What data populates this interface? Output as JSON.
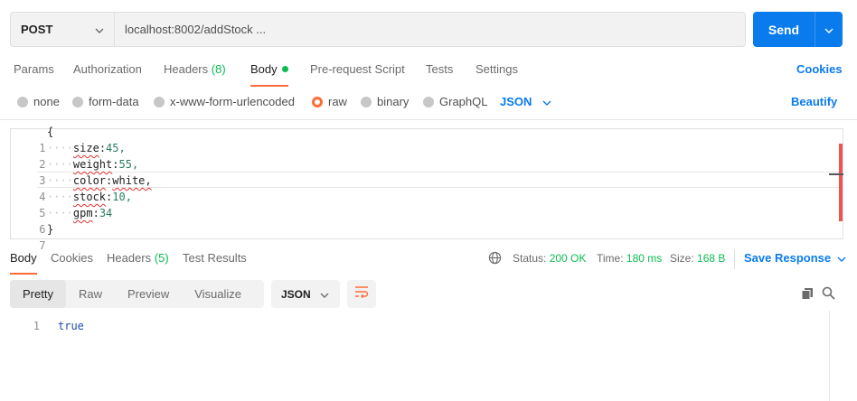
{
  "request": {
    "method": "POST",
    "url": "localhost:8002/addStock ...",
    "send_label": "Send"
  },
  "tabs": [
    {
      "label": "Params"
    },
    {
      "label": "Authorization"
    },
    {
      "label": "Headers",
      "count": "(8)"
    },
    {
      "label": "Body"
    },
    {
      "label": "Pre-request Script"
    },
    {
      "label": "Tests"
    },
    {
      "label": "Settings"
    }
  ],
  "cookies_label": "Cookies",
  "body_types": [
    {
      "label": "none",
      "selected": false
    },
    {
      "label": "form-data",
      "selected": false
    },
    {
      "label": "x-www-form-urlencoded",
      "selected": false
    },
    {
      "label": "raw",
      "selected": true
    },
    {
      "label": "binary",
      "selected": false
    },
    {
      "label": "GraphQL",
      "selected": false
    }
  ],
  "raw_format": "JSON",
  "beautify_label": "Beautify",
  "editor": {
    "line_numbers": [
      "1",
      "2",
      "3",
      "4",
      "5",
      "6",
      "7"
    ],
    "lines": [
      {
        "key": "{",
        "value": ""
      },
      {
        "key": "size",
        "value": "45,"
      },
      {
        "key": "weight",
        "value": "55,"
      },
      {
        "key": "color",
        "value": "white,"
      },
      {
        "key": "stock",
        "value": "10,"
      },
      {
        "key": "gpm",
        "value": "34"
      },
      {
        "key": "}",
        "value": ""
      }
    ]
  },
  "response": {
    "tabs": [
      {
        "label": "Body"
      },
      {
        "label": "Cookies"
      },
      {
        "label": "Headers",
        "count": "(5)"
      },
      {
        "label": "Test Results"
      }
    ],
    "status_label": "Status:",
    "status_value": "200 OK",
    "time_label": "Time:",
    "time_value": "180 ms",
    "size_label": "Size:",
    "size_value": "168 B",
    "save_label": "Save Response",
    "views": [
      "Pretty",
      "Raw",
      "Preview",
      "Visualize"
    ],
    "format": "JSON",
    "line_number": "1",
    "body": "true"
  },
  "colors": {
    "accent": "#097bed",
    "tab_indicator": "#ff6c37",
    "success": "#0cbb52"
  },
  "icons": [
    "chevron-down-icon",
    "globe-icon",
    "copy-icon",
    "search-icon",
    "wrap-lines-icon"
  ]
}
